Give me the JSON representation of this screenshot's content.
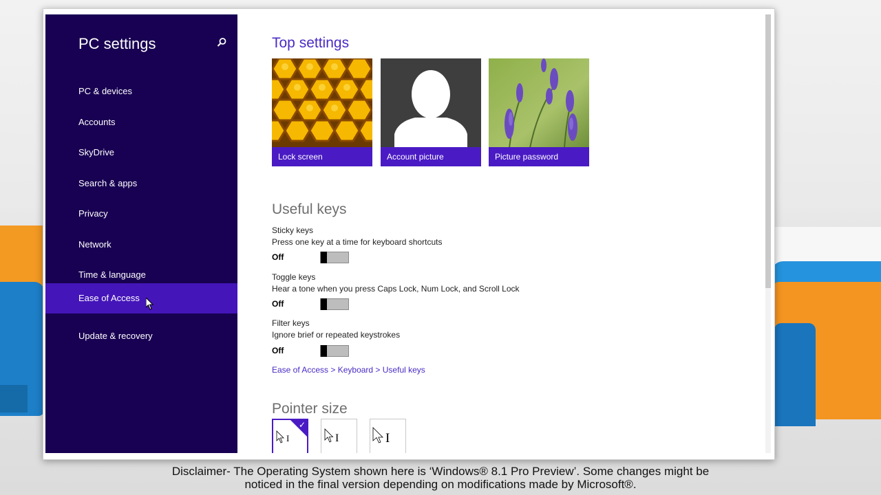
{
  "sidebar": {
    "title": "PC settings",
    "items": [
      {
        "label": "PC & devices"
      },
      {
        "label": "Accounts"
      },
      {
        "label": "SkyDrive"
      },
      {
        "label": "Search & apps"
      },
      {
        "label": "Privacy"
      },
      {
        "label": "Network"
      },
      {
        "label": "Time & language"
      },
      {
        "label": "Ease of Access"
      },
      {
        "label": "Update & recovery"
      }
    ],
    "selected": "Ease of Access"
  },
  "main": {
    "top_settings_title": "Top settings",
    "tiles": [
      {
        "label": "Lock screen"
      },
      {
        "label": "Account picture"
      },
      {
        "label": "Picture password"
      }
    ],
    "useful_keys_title": "Useful keys",
    "keys": [
      {
        "name": "Sticky keys",
        "desc": "Press one key at a time for keyboard shortcuts",
        "state": "Off"
      },
      {
        "name": "Toggle keys",
        "desc": "Hear a tone when you press Caps Lock, Num Lock, and Scroll Lock",
        "state": "Off"
      },
      {
        "name": "Filter keys",
        "desc": "Ignore brief or repeated keystrokes",
        "state": "Off"
      }
    ],
    "path_link": "Ease of Access > Keyboard > Useful keys",
    "pointer_size_title": "Pointer size"
  },
  "disclaimer": {
    "line1": "Disclaimer- The Operating System shown here is ‘Windows® 8.1 Pro Preview’. Some changes might be",
    "line2": "noticed in the final version depending on modifications made by Microsoft®."
  },
  "colors": {
    "sidebar_bg": "#180052",
    "selected_bg": "#4415b9",
    "accent": "#4a1bc4"
  }
}
